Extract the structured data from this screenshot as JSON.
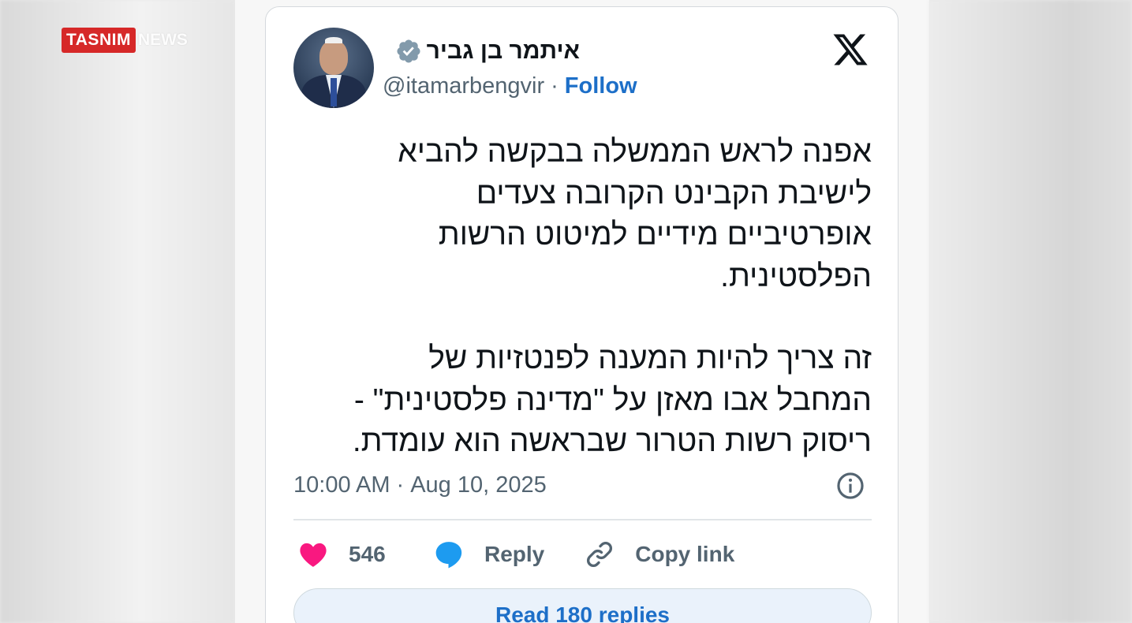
{
  "watermark": {
    "brand": "TASNIM",
    "suffix": "NEWS"
  },
  "colors": {
    "follow": "#1d6fc8",
    "like": "#f91880",
    "reply_icon": "#1d9bf0",
    "verified": "#829aab",
    "text": "#0f1419",
    "muted": "#536471"
  },
  "tweet": {
    "author_name": "איתמר בן גביר",
    "handle": "@itamarbengvir",
    "separator": "·",
    "follow_label": "Follow",
    "paragraphs": [
      "אפנה לראש הממשלה בבקשה להביא\nלישיבת הקבינט הקרובה צעדים\nאופרטיביים מידיים למיטוט הרשות\nהפלסטינית.",
      "זה צריך להיות המענה לפנטזיות של\nהמחבל אבו מאזן על \"מדינה פלסטינית\" -\nריסוק רשות הטרור שבראשה הוא עומדת."
    ],
    "time": "10:00 AM",
    "date_separator": "·",
    "date": "Aug 10, 2025",
    "likes": "546",
    "reply_label": "Reply",
    "copy_label": "Copy link",
    "read_replies_label": "Read 180 replies"
  },
  "icons": [
    "x-logo-icon",
    "verified-badge-icon",
    "info-icon",
    "heart-icon",
    "reply-bubble-icon",
    "link-icon"
  ]
}
